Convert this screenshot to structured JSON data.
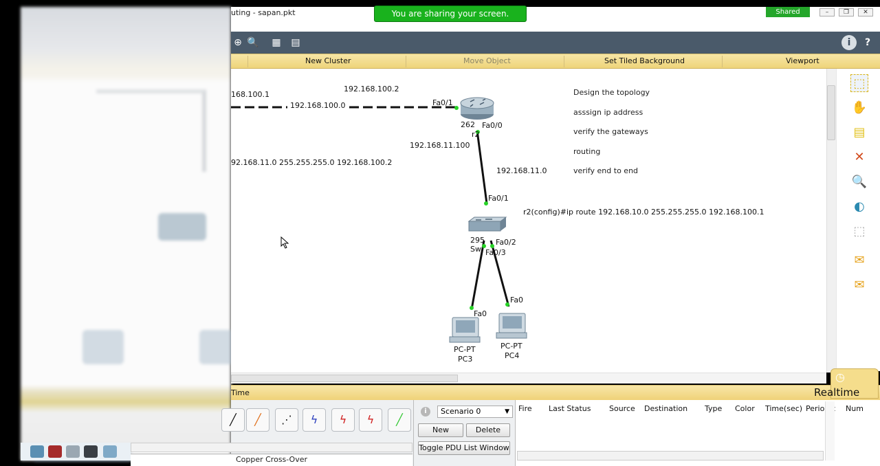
{
  "window": {
    "title_fragment": "uting - sapan.pkt",
    "share_banner": "You are sharing your screen.",
    "shared_badge": "Shared"
  },
  "logical_bar": {
    "new_cluster": "New Cluster",
    "move_object": "Move Object",
    "set_tiled_background": "Set Tiled Background",
    "viewport": "Viewport"
  },
  "topology": {
    "labels": {
      "ip_left": "168.100.1",
      "ip_top": "192.168.100.2",
      "link_net": "192.168.100.0",
      "r_fa01": "Fa0/1",
      "r_model": "262",
      "r_fa00": "Fa0/0",
      "r_name": "r2",
      "ip_r_lan": "192.168.11.100",
      "route_text": "92.168.11.0 255.255.255.0 192.168.100.2",
      "lan_net": "192.168.11.0",
      "sw_fa01": "Fa0/1",
      "sw_model": "295",
      "sw_name": "Sw",
      "sw_fa02": "Fa0/2",
      "sw_fa03": "Fa0/3",
      "pc3_fa0": "Fa0",
      "pc4_fa0": "Fa0",
      "pc3_type": "PC-PT",
      "pc3_name": "PC3",
      "pc4_type": "PC-PT",
      "pc4_name": "PC4",
      "cli_command": "r2(config)#ip route 192.168.10.0 255.255.255.0 192.168.100.1"
    },
    "notes": [
      "Design the topology",
      "asssign ip address",
      "verify the gateways",
      "routing",
      "verify end to end"
    ]
  },
  "timebar": {
    "time": "Time",
    "realtime": "Realtime"
  },
  "scenario": {
    "selected": "Scenario 0",
    "new": "New",
    "delete": "Delete",
    "toggle": "Toggle PDU List Window"
  },
  "pdu_table": {
    "columns": [
      "Fire",
      "Last Status",
      "Source",
      "Destination",
      "Type",
      "Color",
      "Time(sec)",
      "Periodic",
      "Num"
    ]
  },
  "connections": {
    "footer": "Copper Cross-Over"
  }
}
